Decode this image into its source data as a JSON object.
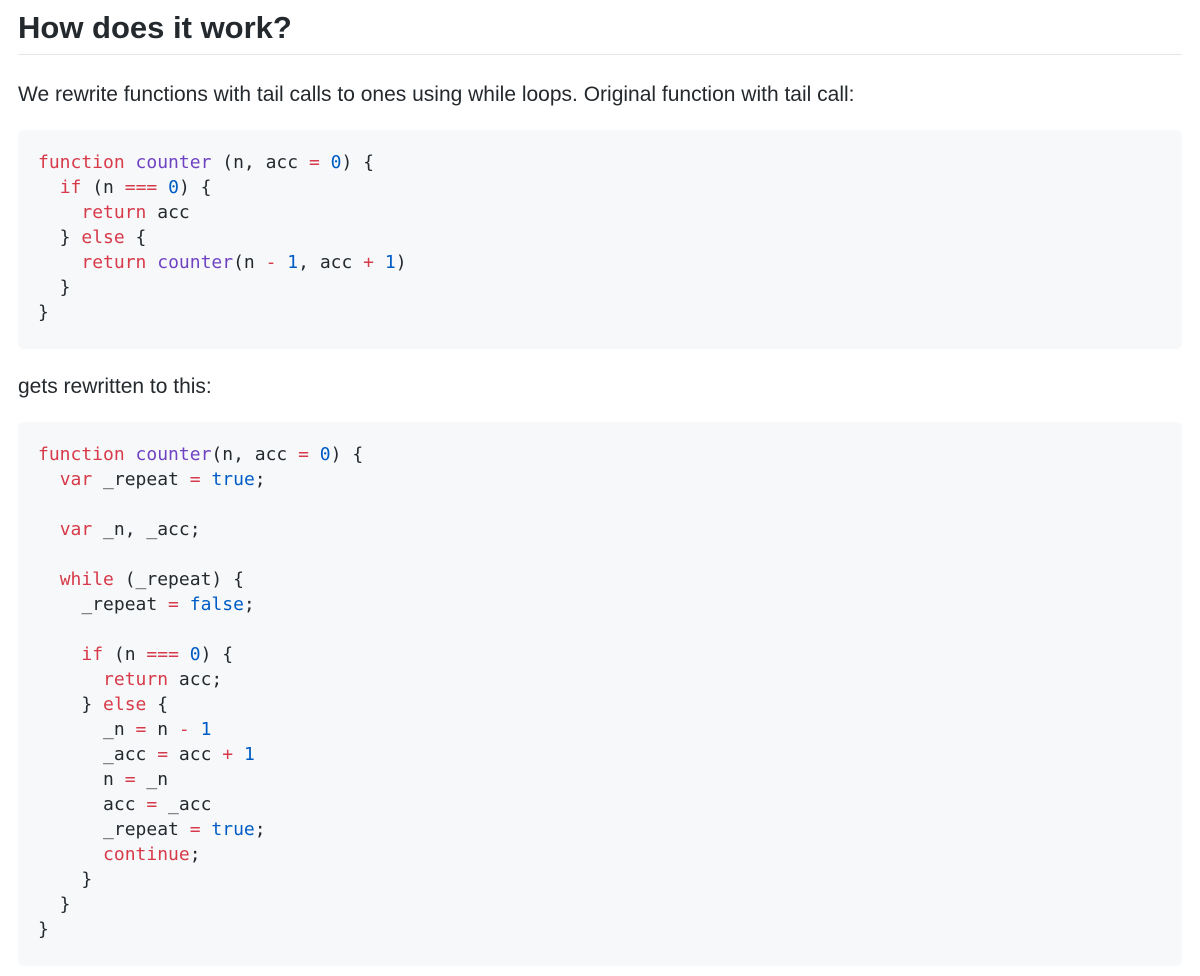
{
  "heading": "How does it work?",
  "intro": "We rewrite functions with tail calls to ones using while loops. Original function with tail call:",
  "transition": "gets rewritten to this:",
  "colors": {
    "keyword": "#d73a49",
    "function": "#6f42c1",
    "number": "#005cc5",
    "text": "#24292e",
    "code_background": "#f6f8fa"
  },
  "original_code": [
    [
      [
        "kw",
        "function"
      ],
      [
        "t",
        " "
      ],
      [
        "fn",
        "counter"
      ],
      [
        "t",
        " (n, acc "
      ],
      [
        "op",
        "="
      ],
      [
        "t",
        " "
      ],
      [
        "num",
        "0"
      ],
      [
        "t",
        ") {"
      ]
    ],
    [
      [
        "t",
        "  "
      ],
      [
        "kw",
        "if"
      ],
      [
        "t",
        " (n "
      ],
      [
        "op",
        "==="
      ],
      [
        "t",
        " "
      ],
      [
        "num",
        "0"
      ],
      [
        "t",
        ") {"
      ]
    ],
    [
      [
        "t",
        "    "
      ],
      [
        "kw",
        "return"
      ],
      [
        "t",
        " acc"
      ]
    ],
    [
      [
        "t",
        "  } "
      ],
      [
        "kw",
        "else"
      ],
      [
        "t",
        " {"
      ]
    ],
    [
      [
        "t",
        "    "
      ],
      [
        "kw",
        "return"
      ],
      [
        "t",
        " "
      ],
      [
        "fn",
        "counter"
      ],
      [
        "t",
        "(n "
      ],
      [
        "op",
        "-"
      ],
      [
        "t",
        " "
      ],
      [
        "num",
        "1"
      ],
      [
        "t",
        ", acc "
      ],
      [
        "op",
        "+"
      ],
      [
        "t",
        " "
      ],
      [
        "num",
        "1"
      ],
      [
        "t",
        ")"
      ]
    ],
    [
      [
        "t",
        "  }"
      ]
    ],
    [
      [
        "t",
        "}"
      ]
    ]
  ],
  "rewritten_code": [
    [
      [
        "kw",
        "function"
      ],
      [
        "t",
        " "
      ],
      [
        "fn",
        "counter"
      ],
      [
        "t",
        "(n, acc "
      ],
      [
        "op",
        "="
      ],
      [
        "t",
        " "
      ],
      [
        "num",
        "0"
      ],
      [
        "t",
        ") {"
      ]
    ],
    [
      [
        "t",
        "  "
      ],
      [
        "kw",
        "var"
      ],
      [
        "t",
        " _repeat "
      ],
      [
        "op",
        "="
      ],
      [
        "t",
        " "
      ],
      [
        "num",
        "true"
      ],
      [
        "t",
        ";"
      ]
    ],
    [],
    [
      [
        "t",
        "  "
      ],
      [
        "kw",
        "var"
      ],
      [
        "t",
        " _n, _acc;"
      ]
    ],
    [],
    [
      [
        "t",
        "  "
      ],
      [
        "kw",
        "while"
      ],
      [
        "t",
        " (_repeat) {"
      ]
    ],
    [
      [
        "t",
        "    _repeat "
      ],
      [
        "op",
        "="
      ],
      [
        "t",
        " "
      ],
      [
        "num",
        "false"
      ],
      [
        "t",
        ";"
      ]
    ],
    [],
    [
      [
        "t",
        "    "
      ],
      [
        "kw",
        "if"
      ],
      [
        "t",
        " (n "
      ],
      [
        "op",
        "==="
      ],
      [
        "t",
        " "
      ],
      [
        "num",
        "0"
      ],
      [
        "t",
        ") {"
      ]
    ],
    [
      [
        "t",
        "      "
      ],
      [
        "kw",
        "return"
      ],
      [
        "t",
        " acc;"
      ]
    ],
    [
      [
        "t",
        "    } "
      ],
      [
        "kw",
        "else"
      ],
      [
        "t",
        " {"
      ]
    ],
    [
      [
        "t",
        "      _n "
      ],
      [
        "op",
        "="
      ],
      [
        "t",
        " n "
      ],
      [
        "op",
        "-"
      ],
      [
        "t",
        " "
      ],
      [
        "num",
        "1"
      ]
    ],
    [
      [
        "t",
        "      _acc "
      ],
      [
        "op",
        "="
      ],
      [
        "t",
        " acc "
      ],
      [
        "op",
        "+"
      ],
      [
        "t",
        " "
      ],
      [
        "num",
        "1"
      ]
    ],
    [
      [
        "t",
        "      n "
      ],
      [
        "op",
        "="
      ],
      [
        "t",
        " _n"
      ]
    ],
    [
      [
        "t",
        "      acc "
      ],
      [
        "op",
        "="
      ],
      [
        "t",
        " _acc"
      ]
    ],
    [
      [
        "t",
        "      _repeat "
      ],
      [
        "op",
        "="
      ],
      [
        "t",
        " "
      ],
      [
        "num",
        "true"
      ],
      [
        "t",
        ";"
      ]
    ],
    [
      [
        "t",
        "      "
      ],
      [
        "kw",
        "continue"
      ],
      [
        "t",
        ";"
      ]
    ],
    [
      [
        "t",
        "    }"
      ]
    ],
    [
      [
        "t",
        "  }"
      ]
    ],
    [
      [
        "t",
        "}"
      ]
    ]
  ]
}
